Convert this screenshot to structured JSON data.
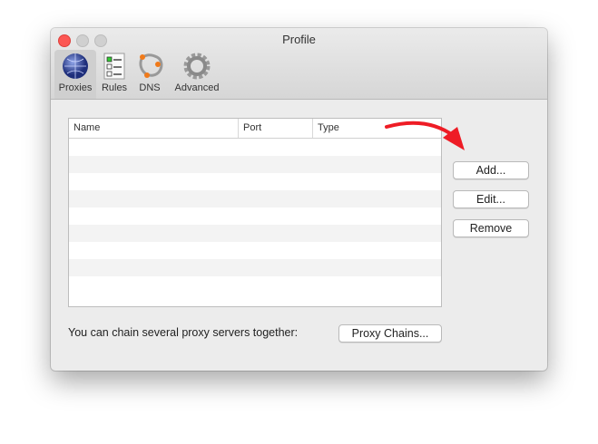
{
  "window": {
    "title": "Profile"
  },
  "toolbar": [
    {
      "label": "Proxies",
      "icon": "globe-icon",
      "selected": true
    },
    {
      "label": "Rules",
      "icon": "checklist-icon"
    },
    {
      "label": "DNS",
      "icon": "dns-network-icon"
    },
    {
      "label": "Advanced",
      "icon": "gear-icon"
    }
  ],
  "table": {
    "columns": [
      "Name",
      "Port",
      "Type"
    ],
    "rows": []
  },
  "buttons": {
    "add": "Add...",
    "edit": "Edit...",
    "remove": "Remove",
    "proxy_chains": "Proxy Chains..."
  },
  "footer": {
    "text": "You can chain several proxy servers together:"
  },
  "colors": {
    "annotation_arrow": "#ee1c25"
  }
}
